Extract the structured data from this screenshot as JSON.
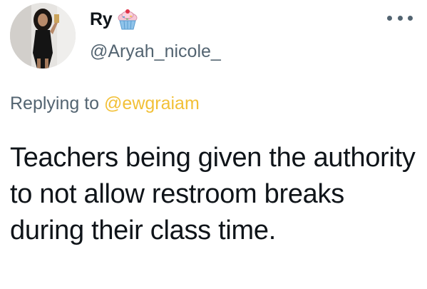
{
  "tweet": {
    "display_name": "Ry",
    "name_emoji_icon": "cupcake-icon",
    "username": "@Aryah_nicole_",
    "replying_prefix": "Replying to",
    "replying_mention": "@ewgraiam",
    "text": "Teachers being given the authority to not allow restroom breaks during their class time.",
    "more_icon": "more-horizontal-icon"
  },
  "colors": {
    "text": "#0f1419",
    "secondary": "#536471",
    "mention": "#f2c037"
  }
}
